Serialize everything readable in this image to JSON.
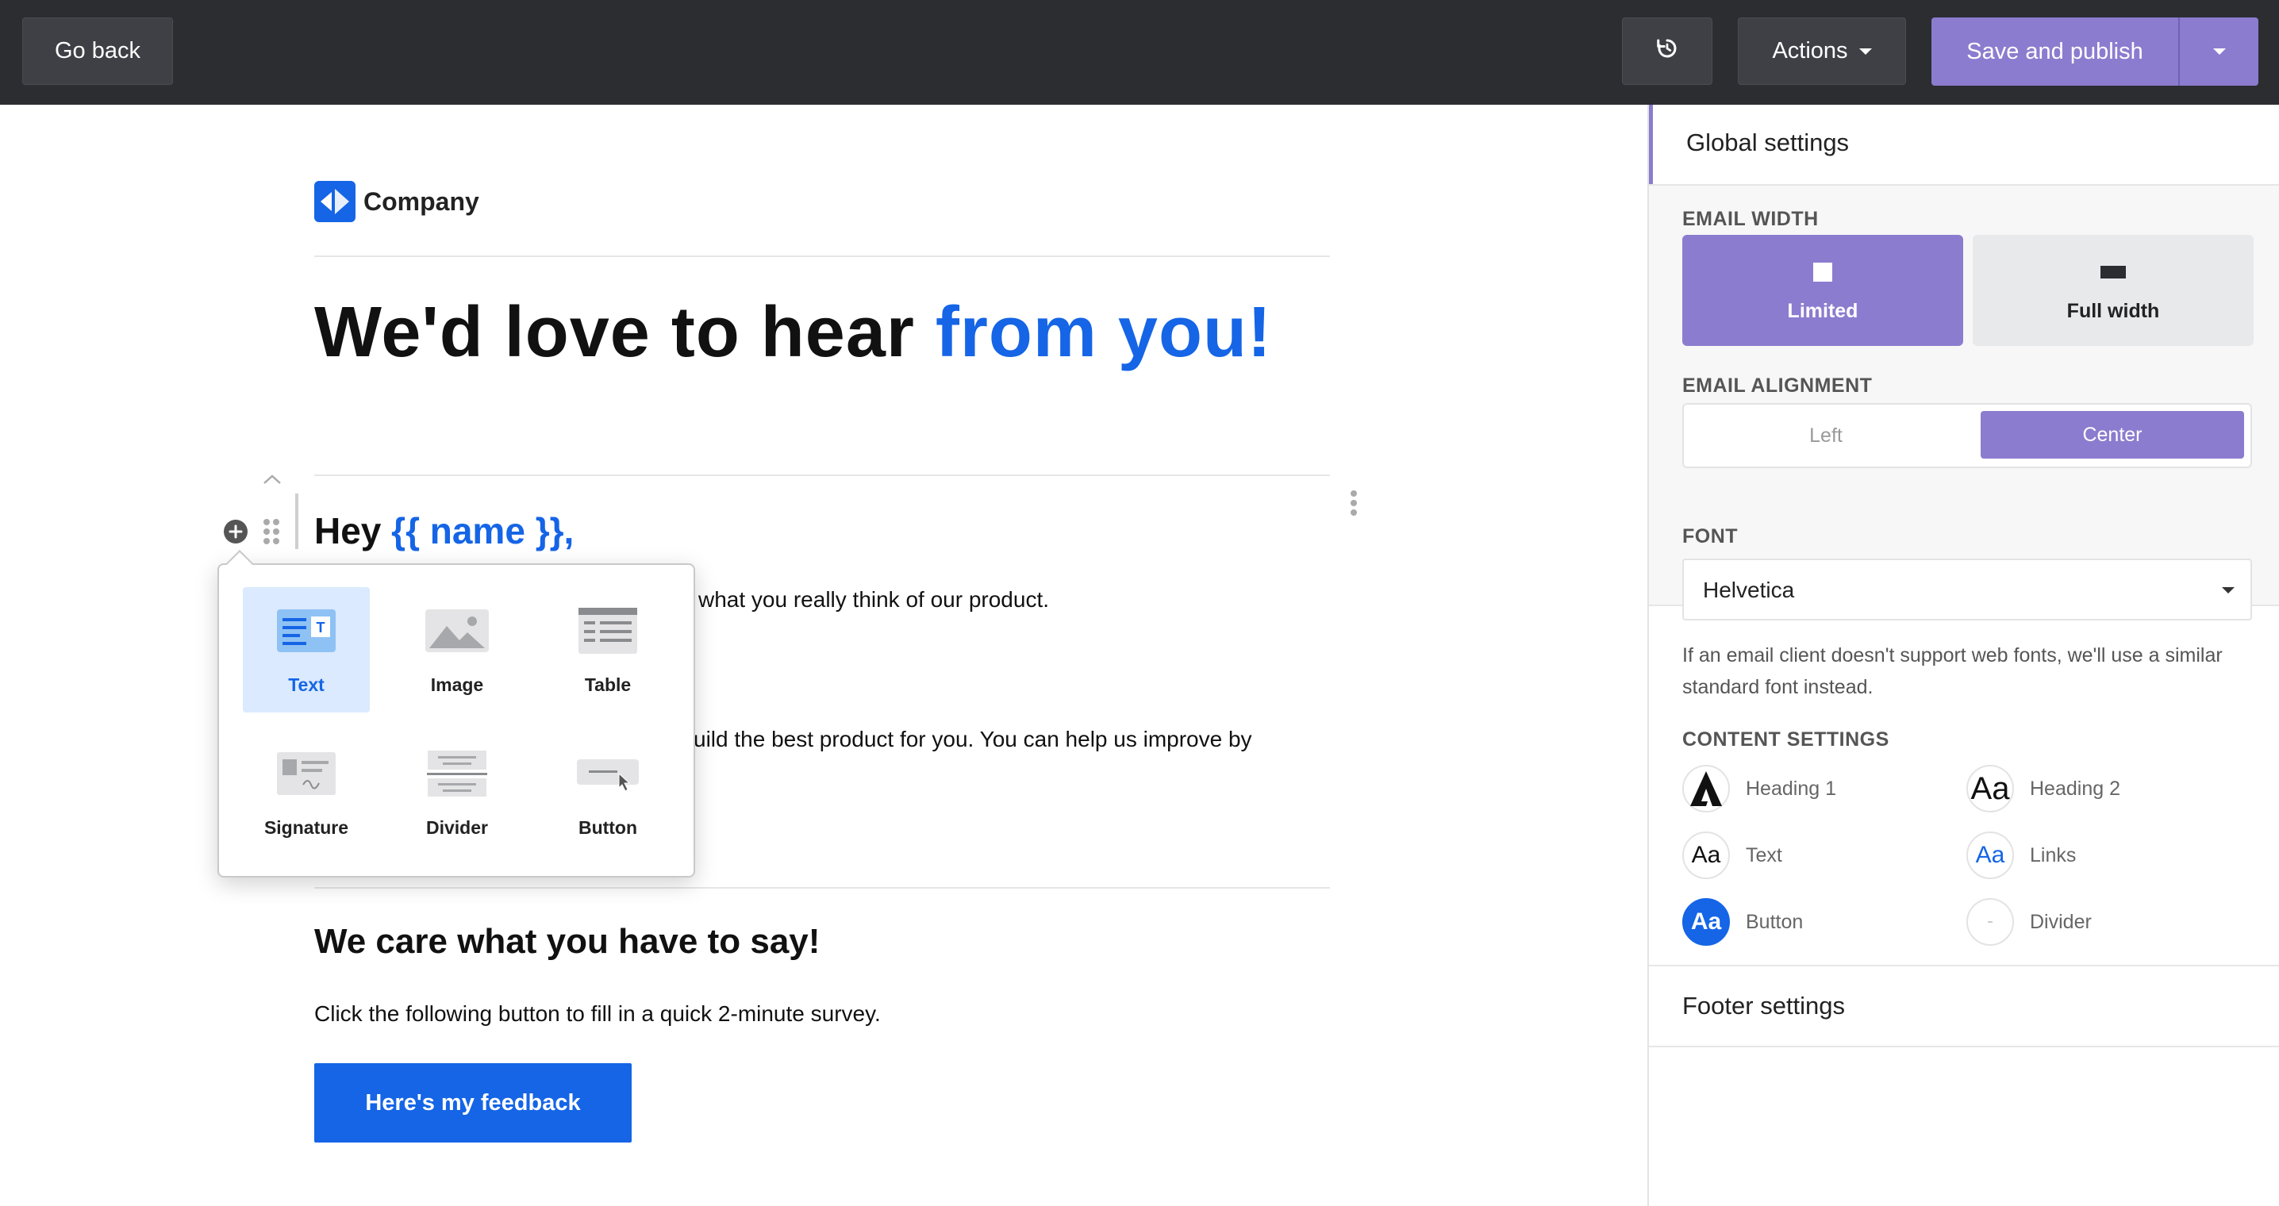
{
  "toolbar": {
    "go_back": "Go back",
    "actions": "Actions",
    "save_publish": "Save and publish"
  },
  "email": {
    "logo_text": "Company",
    "headline_main": "We'd love to hear ",
    "headline_accent": "from you!",
    "greeting_prefix": "Hey ",
    "greeting_var": "{{ name }},",
    "para1_visible": "what you really think of our product.",
    "para2_visible": "uild the best product for you. You can help us improve by",
    "section_title": "We care what you have to say!",
    "section_text": "Click the following button to fill in a quick 2-minute survey.",
    "cta_label": "Here's my feedback"
  },
  "insert_menu": {
    "items": [
      {
        "label": "Text",
        "icon": "text-block-icon",
        "active": true
      },
      {
        "label": "Image",
        "icon": "image-block-icon",
        "active": false
      },
      {
        "label": "Table",
        "icon": "table-block-icon",
        "active": false
      },
      {
        "label": "Signature",
        "icon": "signature-block-icon",
        "active": false
      },
      {
        "label": "Divider",
        "icon": "divider-block-icon",
        "active": false
      },
      {
        "label": "Button",
        "icon": "button-block-icon",
        "active": false
      }
    ]
  },
  "panel": {
    "global_settings": "Global settings",
    "email_width_label": "EMAIL WIDTH",
    "width_limited": "Limited",
    "width_full": "Full width",
    "email_alignment_label": "EMAIL ALIGNMENT",
    "align_left": "Left",
    "align_center": "Center",
    "font_label": "FONT",
    "font_value": "Helvetica",
    "font_help": "If an email client doesn't support web fonts, we'll use a similar standard font instead.",
    "content_settings_label": "CONTENT SETTINGS",
    "content_items": {
      "heading1": "Heading 1",
      "heading2": "Heading 2",
      "text": "Text",
      "links": "Links",
      "button": "Button",
      "divider": "Divider"
    },
    "icon_glyphs": {
      "heading2": "Aa",
      "text": "Aa",
      "links": "Aa",
      "button": "Aa"
    },
    "footer_settings": "Footer settings"
  },
  "colors": {
    "accent_purple": "#8c7ccf",
    "brand_blue": "#1565e6",
    "topbar": "#2b2d31"
  }
}
